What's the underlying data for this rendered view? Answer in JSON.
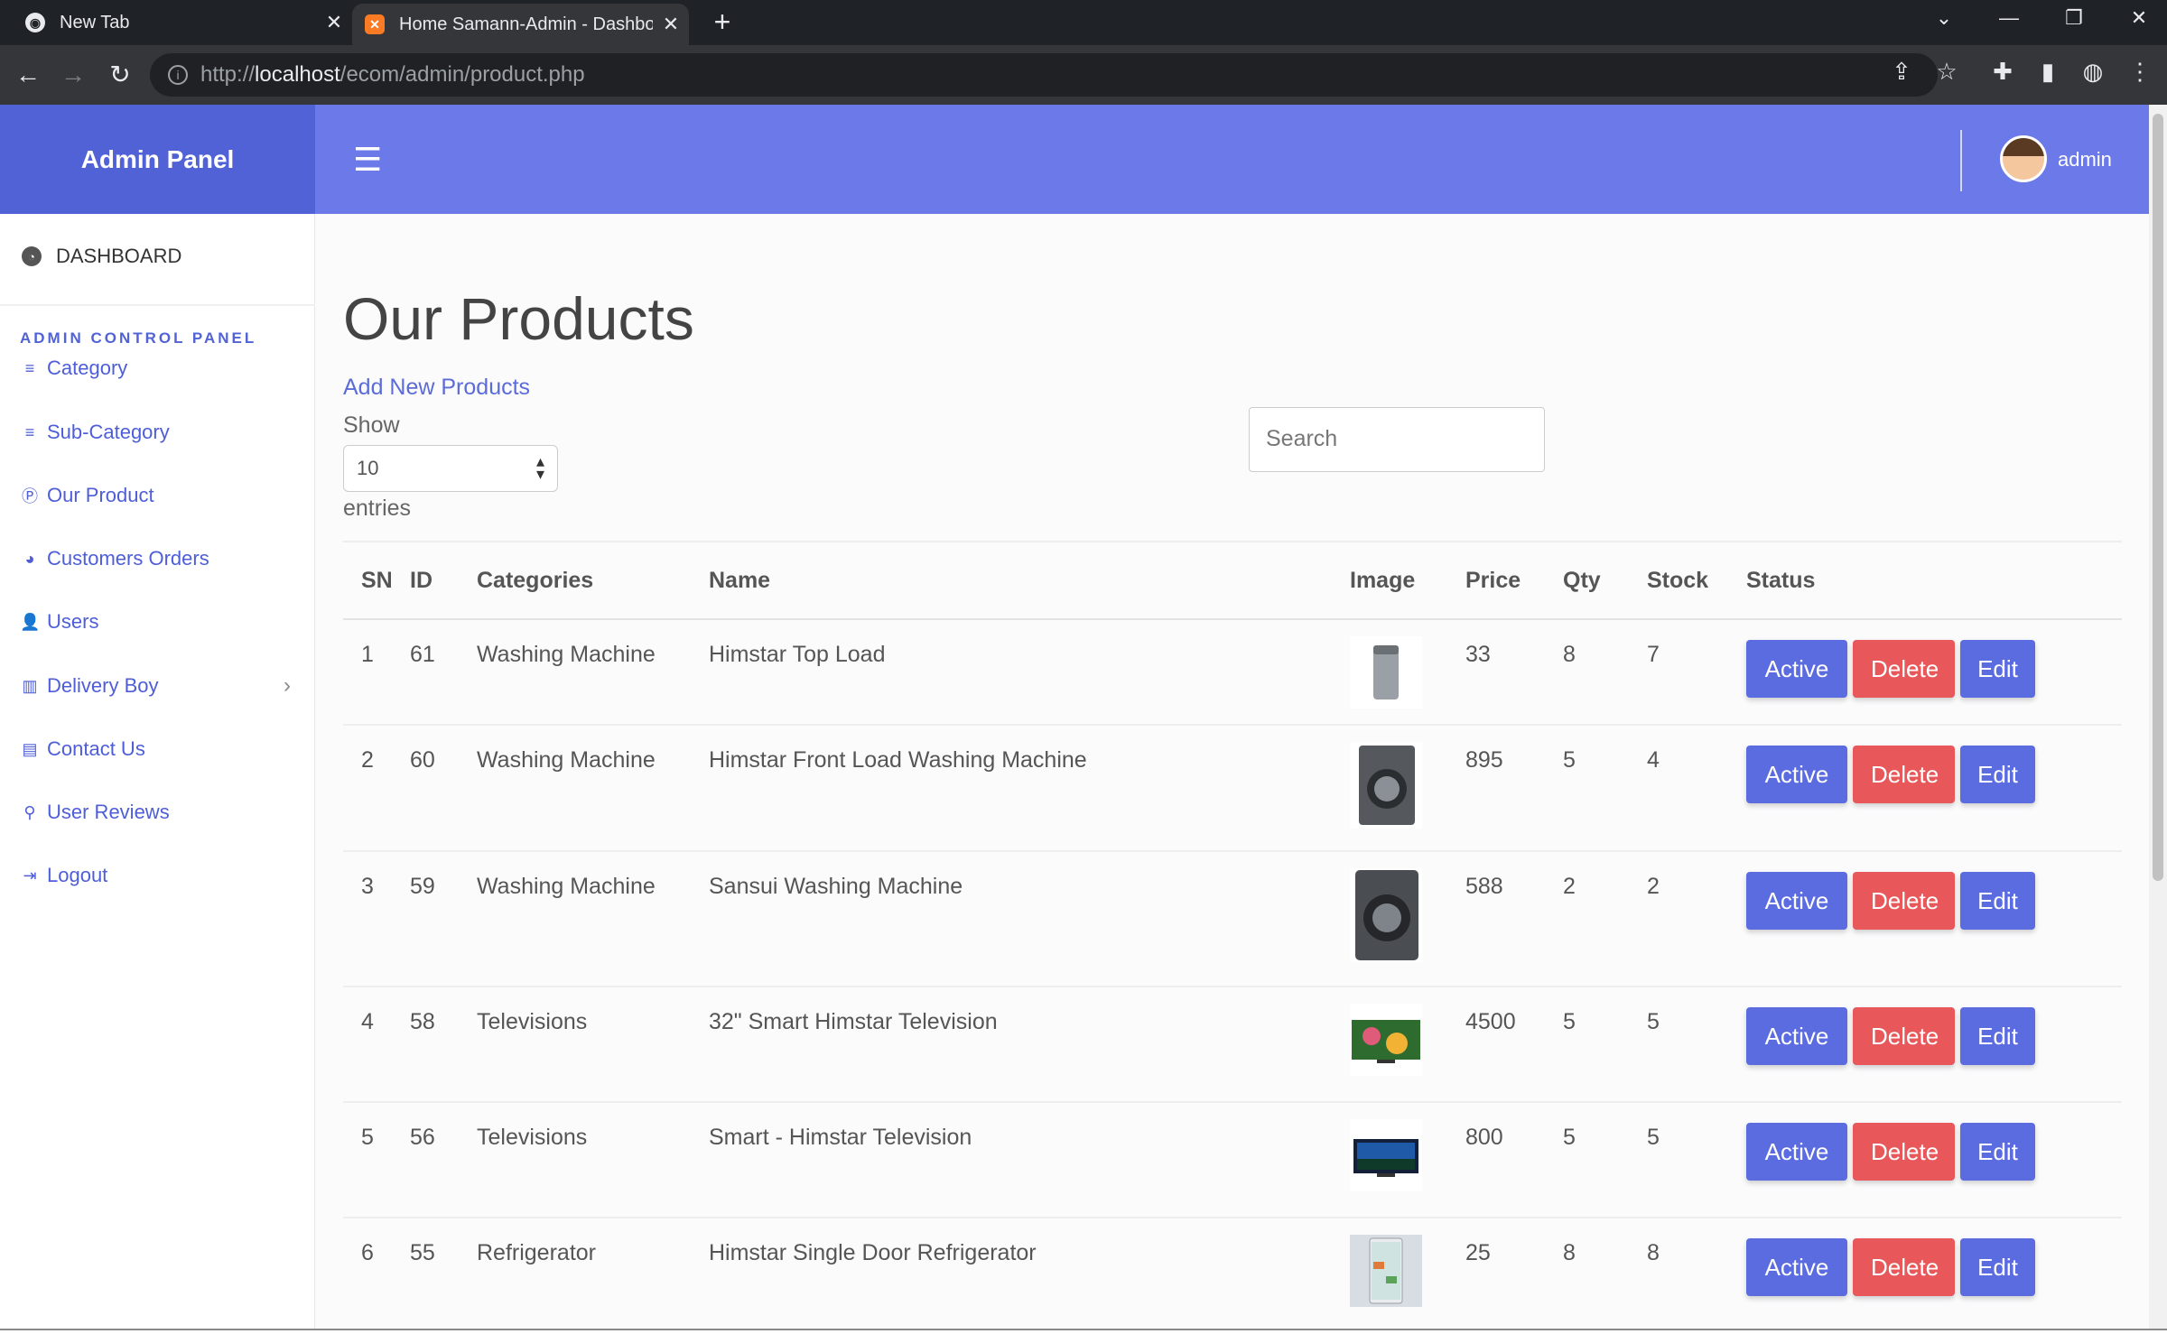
{
  "browser": {
    "tabs": [
      {
        "title": "New Tab",
        "icon": "chrome-icon"
      },
      {
        "title": "Home Samann-Admin - Dashboard",
        "icon": "xampp-icon"
      }
    ],
    "url_host": "localhost",
    "url_prefix": "http://",
    "url_path": "/ecom/admin/product.php"
  },
  "brand": "Admin Panel",
  "user": {
    "name": "admin"
  },
  "sidebar": {
    "dashboard": "DASHBOARD",
    "section_heading": "ADMIN CONTROL PANEL",
    "items": [
      {
        "label": "Category",
        "icon": "list-icon"
      },
      {
        "label": "Sub-Category",
        "icon": "list-icon"
      },
      {
        "label": "Our Product",
        "icon": "product-hunt-icon"
      },
      {
        "label": "Customers Orders",
        "icon": "pie-chart-icon"
      },
      {
        "label": "Users",
        "icon": "user-icon"
      },
      {
        "label": "Delivery Boy",
        "icon": "table-icon"
      },
      {
        "label": "Contact Us",
        "icon": "address-book-icon"
      },
      {
        "label": "User Reviews",
        "icon": "search-icon"
      },
      {
        "label": "Logout",
        "icon": "sign-out-icon"
      }
    ]
  },
  "page": {
    "title": "Our Products",
    "add_link": "Add New Products",
    "show_label": "Show",
    "entries_value": "10",
    "entries_label": "entries",
    "search_placeholder": "Search"
  },
  "table": {
    "headers": [
      "SN",
      "ID",
      "Categories",
      "Name",
      "Image",
      "Price",
      "Qty",
      "Stock",
      "Status"
    ],
    "rows": [
      {
        "sn": "1",
        "id": "61",
        "category": "Washing Machine",
        "name": "Himstar Top Load",
        "image": "top-load-washer",
        "price": "33",
        "qty": "8",
        "stock": "7"
      },
      {
        "sn": "2",
        "id": "60",
        "category": "Washing Machine",
        "name": "Himstar Front Load Washing Machine",
        "image": "front-load-washer",
        "price": "895",
        "qty": "5",
        "stock": "4"
      },
      {
        "sn": "3",
        "id": "59",
        "category": "Washing Machine",
        "name": "Sansui Washing Machine",
        "image": "front-load-washer",
        "price": "588",
        "qty": "2",
        "stock": "2"
      },
      {
        "sn": "4",
        "id": "58",
        "category": "Televisions",
        "name": "32\" Smart Himstar Television",
        "image": "television",
        "price": "4500",
        "qty": "5",
        "stock": "5"
      },
      {
        "sn": "5",
        "id": "56",
        "category": "Televisions",
        "name": "Smart - Himstar Television",
        "image": "television",
        "price": "800",
        "qty": "5",
        "stock": "5"
      },
      {
        "sn": "6",
        "id": "55",
        "category": "Refrigerator",
        "name": "Himstar Single Door Refrigerator",
        "image": "refrigerator",
        "price": "25",
        "qty": "8",
        "stock": "8"
      }
    ],
    "buttons": {
      "active": "Active",
      "delete": "Delete",
      "edit": "Edit"
    }
  },
  "colors": {
    "brand": "#5062d6",
    "topnav": "#6c79e8",
    "primary_button": "#5b6be0",
    "danger_button": "#e8585a",
    "link": "#4d5ed8"
  }
}
